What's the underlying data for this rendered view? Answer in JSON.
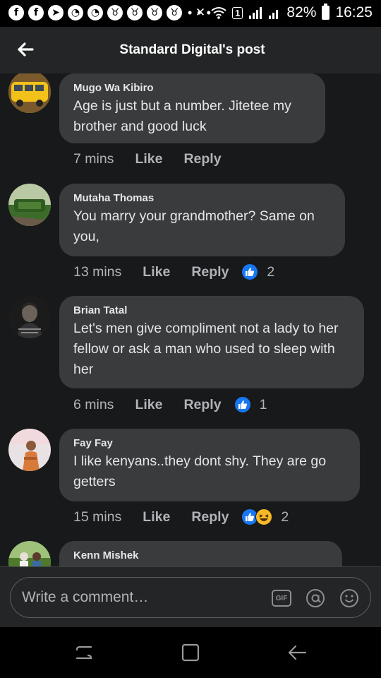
{
  "status_bar": {
    "app_icons": [
      "f",
      "f",
      "➤",
      "◔",
      "◔",
      "♉",
      "♉",
      "♉",
      "♉"
    ],
    "more": "• • •",
    "sim_badge": "1",
    "battery_percent": "82%",
    "time": "16:25"
  },
  "header": {
    "title": "Standard Digital's post"
  },
  "comments": [
    {
      "author": "Mugo Wa Kibiro",
      "text": "Age is just but a number. Jitetee my brother and good luck",
      "time": "7 mins",
      "like_label": "Like",
      "reply_label": "Reply",
      "reactions": null
    },
    {
      "author": "Mutaha Thomas",
      "text": "You marry your grandmother? Same on you,",
      "time": "13 mins",
      "like_label": "Like",
      "reply_label": "Reply",
      "reactions": {
        "types": [
          "like"
        ],
        "count": "2"
      }
    },
    {
      "author": "Brian Tatal",
      "text": "Let's men give compliment not a lady to her fellow or ask a man who used to sleep with her",
      "time": "6 mins",
      "like_label": "Like",
      "reply_label": "Reply",
      "reactions": {
        "types": [
          "like"
        ],
        "count": "1"
      }
    },
    {
      "author": "Fay Fay",
      "text": "I like kenyans..they dont shy. They are go getters",
      "time": "15 mins",
      "like_label": "Like",
      "reply_label": "Reply",
      "reactions": {
        "types": [
          "like",
          "haha"
        ],
        "count": "2"
      }
    },
    {
      "author": "Kenn Mishek"
    }
  ],
  "composer": {
    "placeholder": "Write a comment…",
    "gif_label": "GIF"
  },
  "colors": {
    "background": "#18191a",
    "bubble": "#3a3b3c",
    "header": "#242526",
    "like_blue": "#1877f2",
    "haha_yellow": "#f7b928"
  },
  "icons": {
    "back": "arrow-left-icon",
    "mention": "at-icon",
    "emoji": "smiley-icon",
    "nav_recents": "recents-icon",
    "nav_home": "home-icon",
    "nav_back": "back-icon"
  }
}
